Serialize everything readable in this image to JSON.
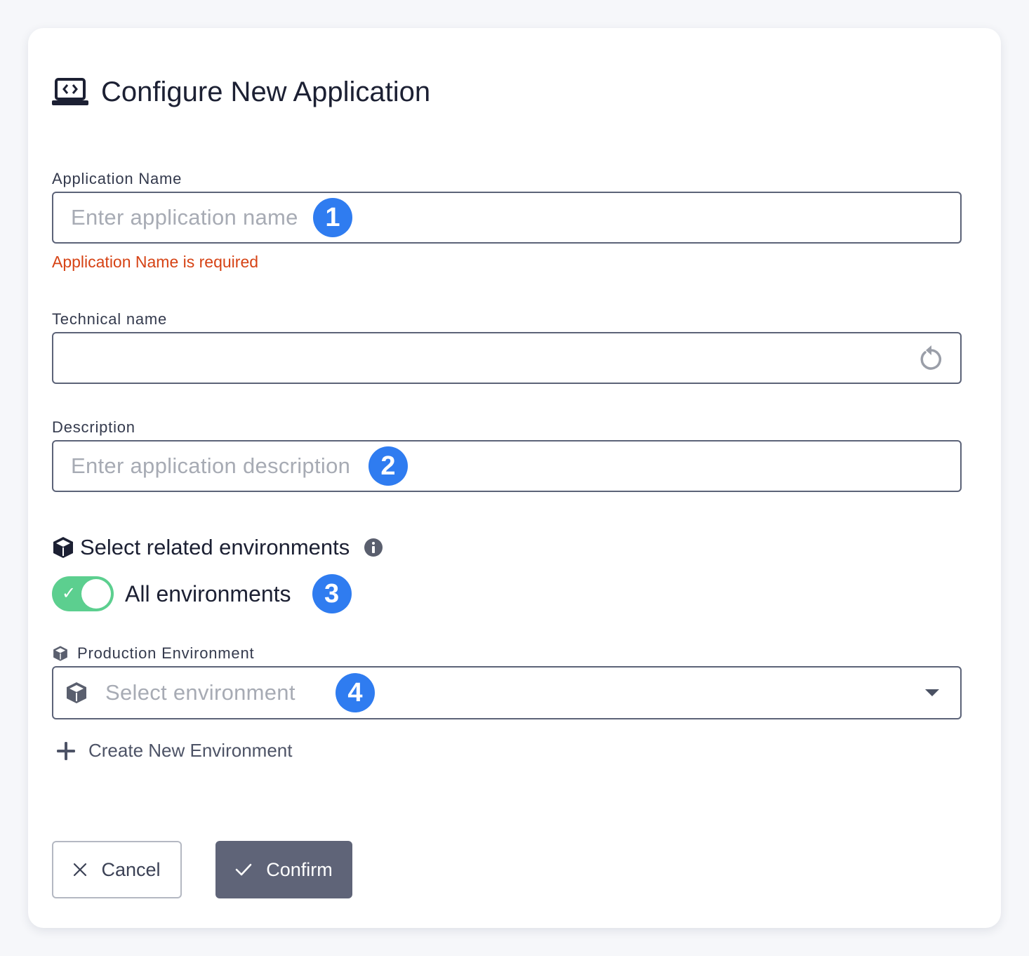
{
  "dialog": {
    "title": "Configure New Application",
    "title_icon": "laptop-code-icon"
  },
  "application_name": {
    "label": "Application Name",
    "placeholder": "Enter application name",
    "value": "",
    "badge": "1",
    "error": "Application Name is required"
  },
  "technical_name": {
    "label": "Technical name",
    "value": "",
    "reset_icon": "reset-icon"
  },
  "description": {
    "label": "Description",
    "placeholder": "Enter application description",
    "value": "",
    "badge": "2"
  },
  "environments": {
    "title": "Select related environments",
    "title_icon": "cube-icon",
    "info_icon": "info-icon",
    "toggle": {
      "label": "All environments",
      "on": true,
      "check": "✓",
      "badge": "3"
    },
    "production": {
      "label": "Production Environment",
      "placeholder": "Select environment",
      "badge": "4"
    },
    "create_link": "Create New Environment"
  },
  "actions": {
    "cancel_label": "Cancel",
    "confirm_label": "Confirm"
  },
  "colors": {
    "badge": "#2f7cf0",
    "error": "#d64315",
    "toggle_on": "#5ccf8f",
    "confirm_bg": "#5f6478"
  }
}
